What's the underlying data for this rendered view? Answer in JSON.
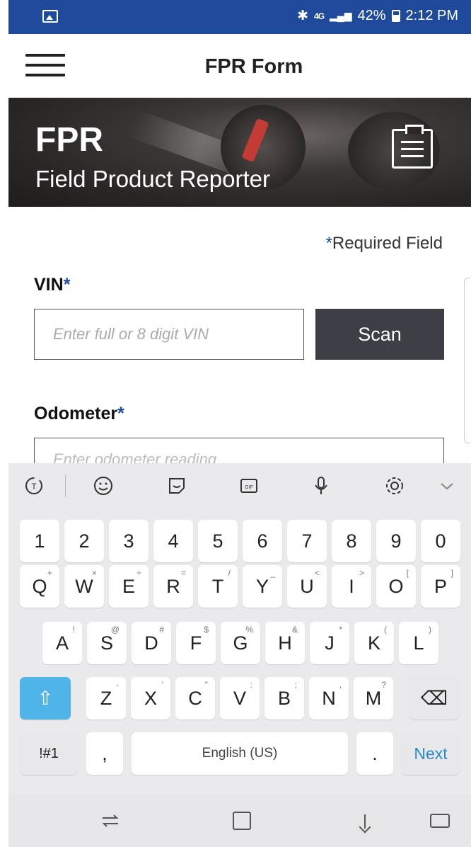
{
  "status_bar": {
    "bluetooth": "∗",
    "network": "4G",
    "battery": "42%",
    "time": "2:12 PM"
  },
  "header": {
    "title": "FPR Form"
  },
  "banner": {
    "title": "FPR",
    "subtitle": "Field Product Reporter"
  },
  "form": {
    "required_note": "Required Field",
    "required_star": "*",
    "vin_label": "VIN",
    "vin_placeholder": "Enter full or 8 digit VIN",
    "scan_label": "Scan",
    "odometer_label": "Odometer",
    "odometer_placeholder": "Enter odometer reading"
  },
  "keyboard": {
    "row_numbers": [
      "1",
      "2",
      "3",
      "4",
      "5",
      "6",
      "7",
      "8",
      "9",
      "0"
    ],
    "row_q": [
      {
        "k": "Q",
        "s": "+"
      },
      {
        "k": "W",
        "s": "×"
      },
      {
        "k": "E",
        "s": "÷"
      },
      {
        "k": "R",
        "s": "="
      },
      {
        "k": "T",
        "s": "/"
      },
      {
        "k": "Y",
        "s": "_"
      },
      {
        "k": "U",
        "s": "<"
      },
      {
        "k": "I",
        "s": ">"
      },
      {
        "k": "O",
        "s": "["
      },
      {
        "k": "P",
        "s": "]"
      }
    ],
    "row_a": [
      {
        "k": "A",
        "s": "!"
      },
      {
        "k": "S",
        "s": "@"
      },
      {
        "k": "D",
        "s": "#"
      },
      {
        "k": "F",
        "s": "$"
      },
      {
        "k": "G",
        "s": "%"
      },
      {
        "k": "H",
        "s": "&"
      },
      {
        "k": "J",
        "s": "*"
      },
      {
        "k": "K",
        "s": "("
      },
      {
        "k": "L",
        "s": ")"
      }
    ],
    "row_z": [
      {
        "k": "Z",
        "s": "-"
      },
      {
        "k": "X",
        "s": "'"
      },
      {
        "k": "C",
        "s": "\""
      },
      {
        "k": "V",
        "s": ":"
      },
      {
        "k": "B",
        "s": ";"
      },
      {
        "k": "N",
        "s": ","
      },
      {
        "k": "M",
        "s": "?"
      }
    ],
    "symbols_label": "!#1",
    "comma_label": ",",
    "space_label": "English (US)",
    "period_label": ".",
    "next_label": "Next",
    "shift_glyph": "⇧",
    "backspace_glyph": "⌫"
  },
  "accent_color": "#1f4a9c",
  "icons": [
    "image-icon",
    "bluetooth-icon",
    "battery-icon",
    "menu-icon",
    "clipboard-icon",
    "translate-icon",
    "emoji-icon",
    "sticker-icon",
    "gif-icon",
    "microphone-icon",
    "settings-icon",
    "chevron-down-icon",
    "recent-apps-icon",
    "home-icon",
    "back-icon",
    "keyboard-icon"
  ]
}
